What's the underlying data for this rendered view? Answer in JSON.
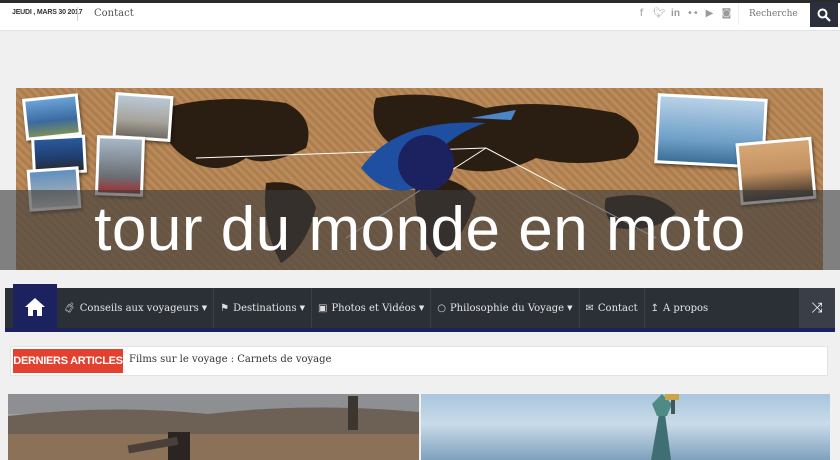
{
  "topbar": {
    "date": "JEUDI , MARS 30 2017",
    "contact_link": "Contact",
    "search_placeholder": "Recherche",
    "social_icons": [
      "facebook-icon",
      "twitter-icon",
      "linkedin-icon",
      "flickr-icon",
      "youtube-icon",
      "instagram-icon"
    ]
  },
  "banner": {
    "title": "tour du monde en moto"
  },
  "nav": {
    "items": [
      {
        "label": "Conseils aux voyageurs",
        "icon": "suitcase-icon",
        "has_dropdown": true
      },
      {
        "label": "Destinations",
        "icon": "signpost-icon",
        "has_dropdown": true
      },
      {
        "label": "Photos et Vidéos",
        "icon": "image-icon",
        "has_dropdown": true
      },
      {
        "label": "Philosophie du Voyage",
        "icon": "speech-bubble-icon",
        "has_dropdown": true
      },
      {
        "label": "Contact",
        "icon": "envelope-icon",
        "has_dropdown": false
      },
      {
        "label": "A propos",
        "icon": "pin-icon",
        "has_dropdown": false
      }
    ]
  },
  "latest": {
    "tag": "DERNIERS ARTICLES",
    "text": "Films sur le voyage : Carnets de voyage"
  },
  "colors": {
    "nav_bg": "#2b2f36",
    "nav_accent": "#1c2260",
    "latest_tag": "#e2412f",
    "search_btn": "#2a2f3b"
  }
}
